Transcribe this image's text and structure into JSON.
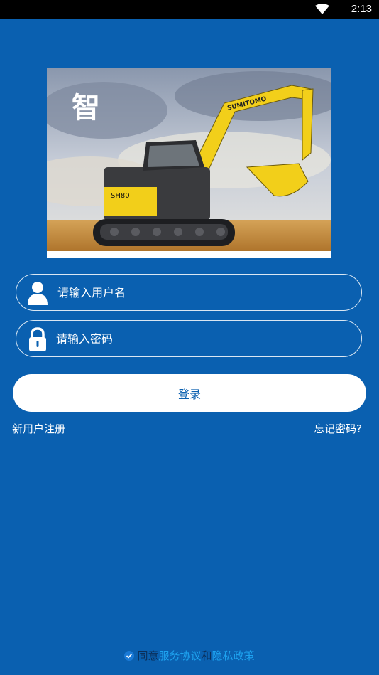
{
  "status_bar": {
    "time": "2:13"
  },
  "banner": {
    "brand_text": "SUMITOMO",
    "model_text": "SH80"
  },
  "username": {
    "placeholder": "请输入用户名",
    "value": ""
  },
  "password": {
    "placeholder": "请输入密码",
    "value": ""
  },
  "login_label": "登录",
  "register_link": "新用户注册",
  "forgot_link": "忘记密码?",
  "agreement": {
    "prefix": "同意",
    "terms": "服务协议",
    "and": "和",
    "privacy": "隐私政策"
  },
  "colors": {
    "background": "#0a60b0",
    "link": "#1ea3f0"
  }
}
